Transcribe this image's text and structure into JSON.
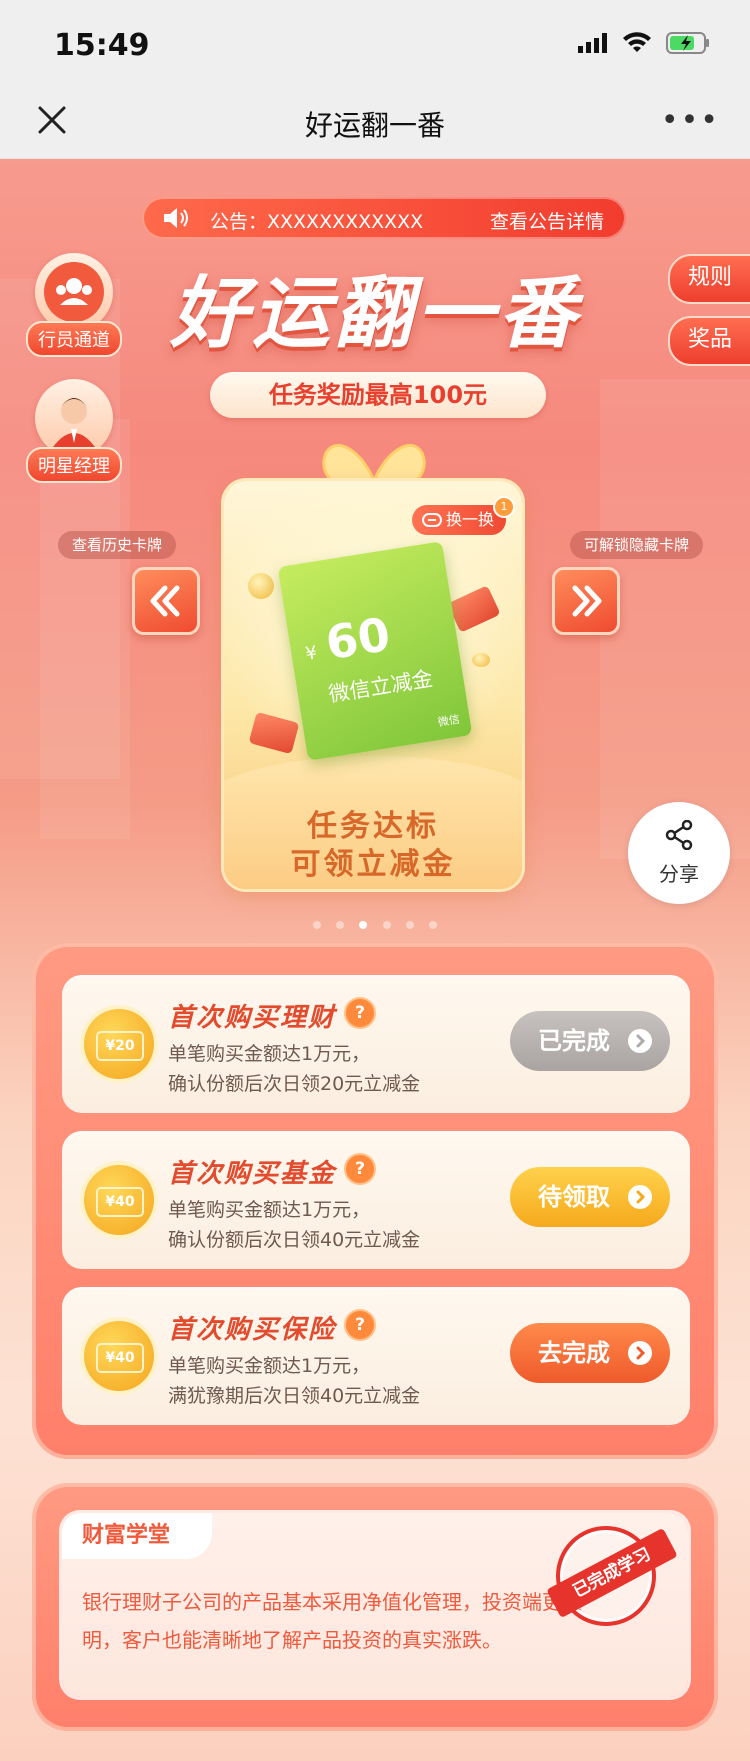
{
  "status": {
    "time": "15:49"
  },
  "nav": {
    "title": "好运翻一番",
    "more": "•••"
  },
  "notice": {
    "text": "公告：XXXXXXXXXXXX",
    "link": "查看公告详情"
  },
  "hero": {
    "title": "好运翻一番",
    "subtitle": "任务奖励最高100元"
  },
  "side_entries": [
    {
      "label": "行员通道"
    },
    {
      "label": "明星经理"
    }
  ],
  "right_tabs": [
    {
      "label": "规则"
    },
    {
      "label": "奖品"
    }
  ],
  "card": {
    "swap_label": "换一换",
    "swap_badge": "1",
    "voucher": {
      "currency": "¥",
      "amount": "60",
      "name": "微信立减金",
      "brand": "微信"
    },
    "bottom_line1": "任务达标",
    "bottom_line2": "可领立减金"
  },
  "carousel": {
    "prev_hint": "查看历史卡牌",
    "next_hint": "可解锁隐藏卡牌",
    "pages": 6,
    "active": 2
  },
  "share": {
    "label": "分享"
  },
  "tasks": [
    {
      "ticket": "¥20",
      "title": "首次购买理财",
      "desc1": "单笔购买金额达1万元，",
      "desc2": "确认份额后次日领20元立减金",
      "button": "已完成",
      "state": "done"
    },
    {
      "ticket": "¥40",
      "title": "首次购买基金",
      "desc1": "单笔购买金额达1万元，",
      "desc2": "确认份额后次日领40元立减金",
      "button": "待领取",
      "state": "claim"
    },
    {
      "ticket": "¥40",
      "title": "首次购买保险",
      "desc1": "单笔购买金额达1万元，",
      "desc2": "满犹豫期后次日领40元立减金",
      "button": "去完成",
      "state": "go"
    }
  ],
  "wisdom": {
    "tab": "财富学堂",
    "text": "银行理财子公司的产品基本采用净值化管理，投资端更透明，客户也能清晰地了解产品投资的真实涨跌。",
    "stamp": "已完成学习"
  },
  "colors": {
    "accent": "#ef4b30",
    "accent_light": "#ff8d5c",
    "gold": "#f5a91c",
    "done_gray": "#a9a4a1"
  }
}
